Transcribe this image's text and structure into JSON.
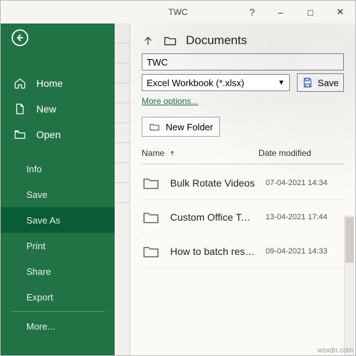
{
  "window": {
    "title": "TWC",
    "help": "?",
    "minimize": "–",
    "maximize": "□",
    "close": "✕"
  },
  "sidebar": {
    "main": [
      {
        "label": "Home"
      },
      {
        "label": "New"
      },
      {
        "label": "Open"
      }
    ],
    "sub": [
      {
        "label": "Info"
      },
      {
        "label": "Save"
      },
      {
        "label": "Save As"
      },
      {
        "label": "Print"
      },
      {
        "label": "Share"
      },
      {
        "label": "Export"
      },
      {
        "label": "More..."
      }
    ]
  },
  "saveas": {
    "location": "Documents",
    "filename": "TWC",
    "filetype": "Excel Workbook (*.xlsx)",
    "save_label": "Save",
    "more_options": "More options...",
    "new_folder": "New Folder",
    "columns": {
      "name": "Name",
      "date": "Date modified"
    },
    "rows": [
      {
        "name": "Bulk Rotate Videos",
        "date": "07-04-2021 14:34"
      },
      {
        "name": "Custom Office Te…",
        "date": "13-04-2021 17:44"
      },
      {
        "name": "How to batch res…",
        "date": "09-04-2021 14:33"
      }
    ]
  },
  "watermark": "wsxdn.com"
}
